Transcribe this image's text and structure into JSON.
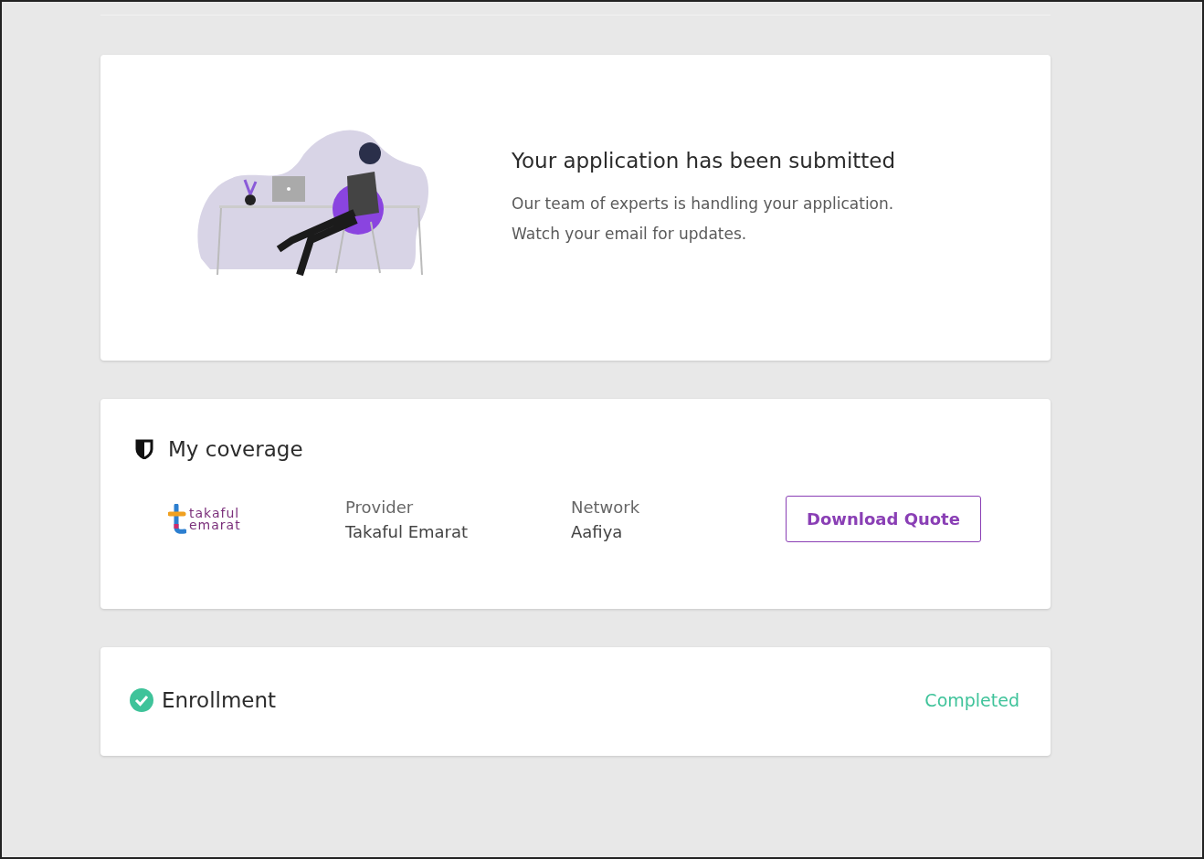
{
  "submission": {
    "title": "Your application has been submitted",
    "message_lines": [
      "Our team of experts is handling your application.",
      "Watch your email for updates."
    ]
  },
  "coverage": {
    "title": "My coverage",
    "logo": {
      "line_1": "takaful",
      "line_2": "emarat"
    },
    "fields": [
      {
        "label": "Provider",
        "value": "Takaful Emarat"
      },
      {
        "label": "Network",
        "value": "Aafiya"
      }
    ],
    "button": "Download Quote"
  },
  "enrollment": {
    "title": "Enrollment",
    "status": "Completed"
  }
}
